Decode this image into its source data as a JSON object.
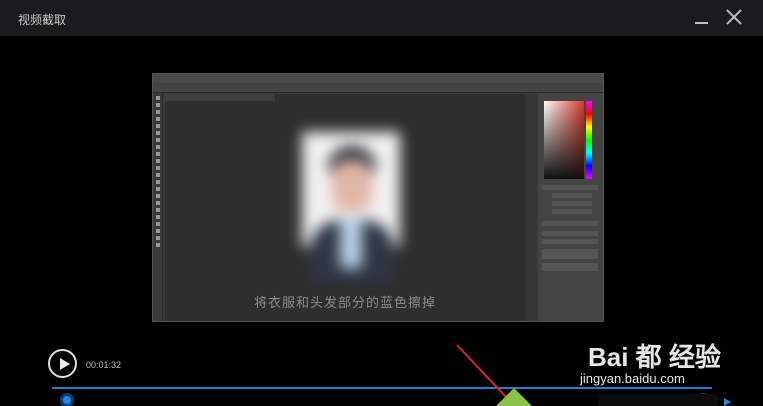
{
  "window": {
    "title": "视频截取"
  },
  "video": {
    "subtitle": "将衣服和头发部分的蓝色擦掉"
  },
  "player": {
    "time": "00:01:32"
  },
  "watermark": {
    "brand": "Bai 都 经验",
    "url": "jingyan.baidu.com"
  },
  "colors": {
    "accent": "#1b7fd1",
    "handle": "#1e88e5",
    "annotation_arrow": "#d8262c",
    "marker": "#8bc34a"
  }
}
